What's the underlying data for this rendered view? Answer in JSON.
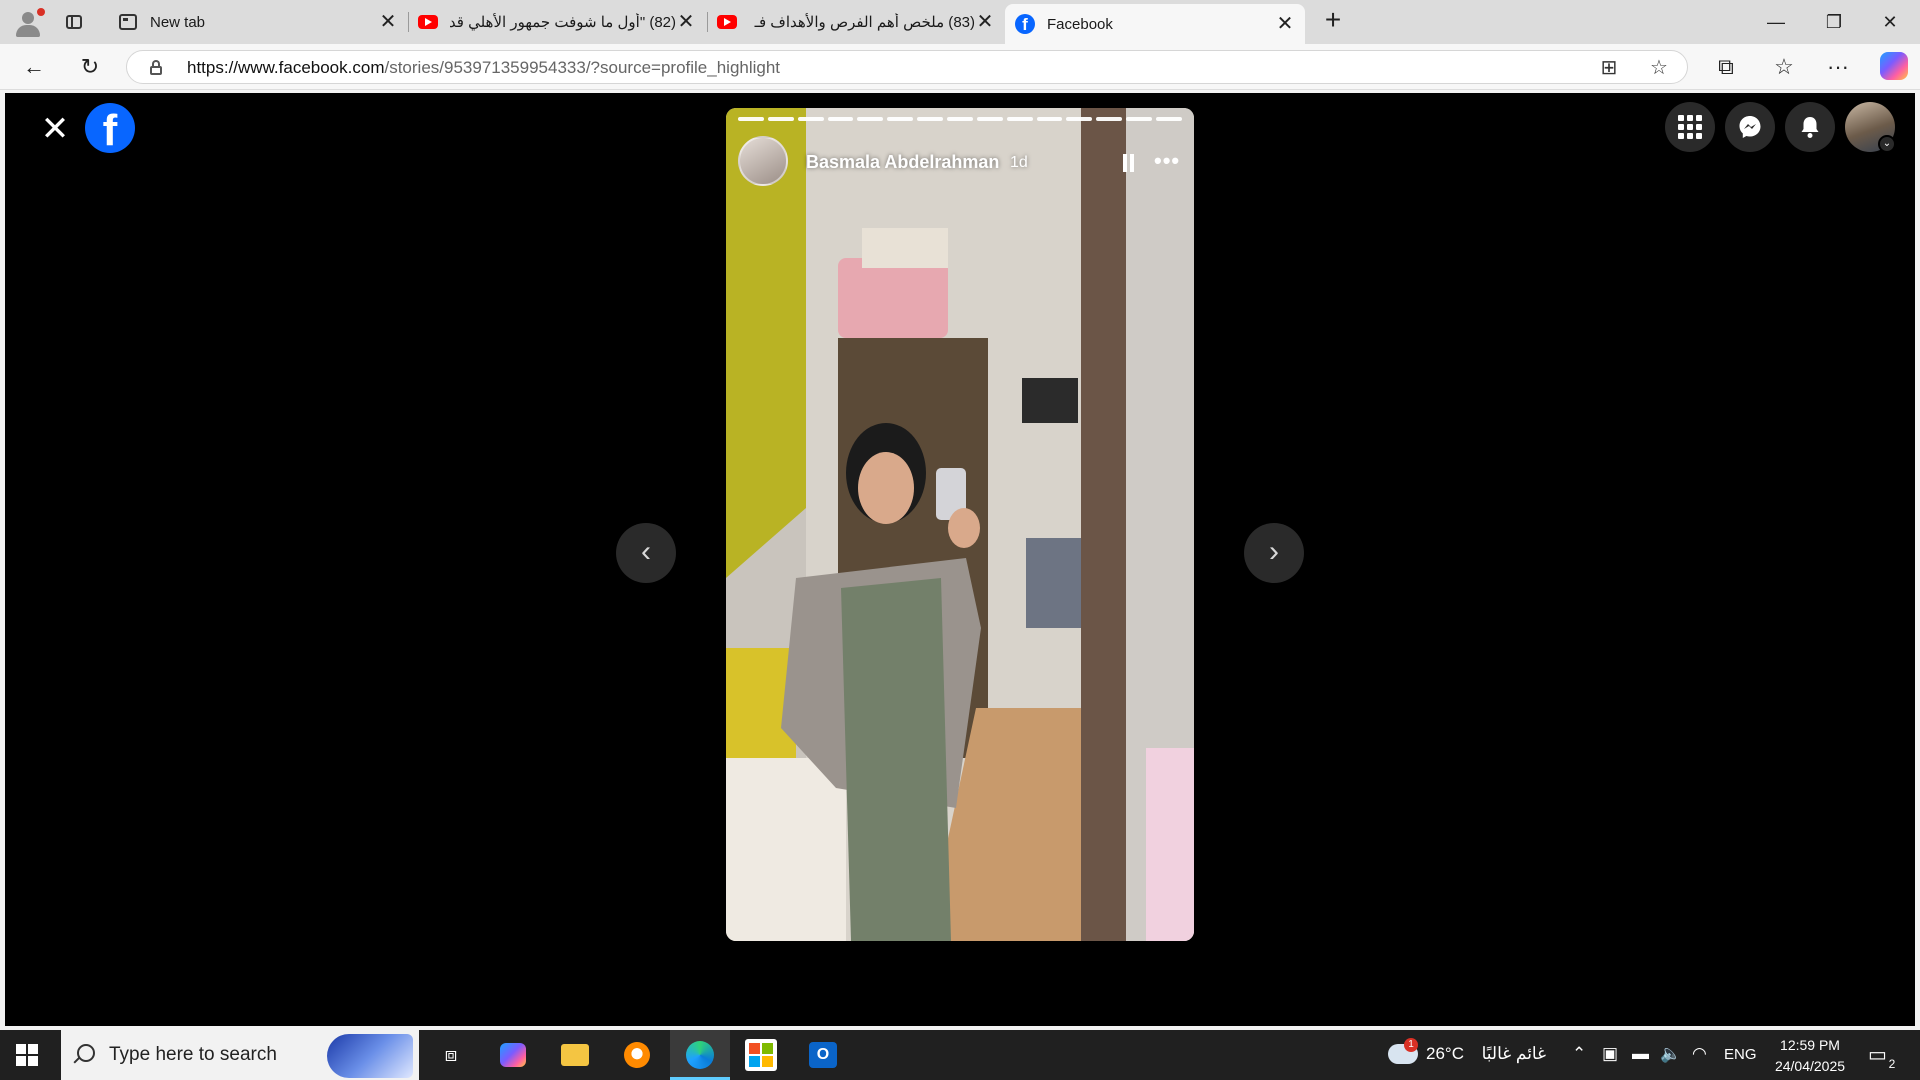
{
  "browser": {
    "tabs": [
      {
        "title": "New tab",
        "icon": "new-tab-icon",
        "active": false
      },
      {
        "title": "(82) \"أول ما شوفت جمهور الأهلي قد",
        "icon": "youtube-icon",
        "active": false
      },
      {
        "title": "(83) ملخص أهم الفرص والأهداف فـ",
        "icon": "youtube-icon",
        "active": false
      },
      {
        "title": "Facebook",
        "icon": "facebook-icon",
        "active": true
      }
    ],
    "url_domain": "https://www.facebook.com",
    "url_path": "/stories/953971359954333/?source=profile_highlight",
    "window_controls": {
      "minimize": "—",
      "restore": "❐",
      "close": "✕"
    }
  },
  "story": {
    "author": "Basmala Abdelrahman",
    "age": "1d",
    "segments": 15,
    "photo_palette": {
      "wall_left": "#b9b324",
      "wall": "#c9c4bd",
      "scrubs": "#73806a",
      "cardigan": "#9a938d",
      "floor": "#c89a6c",
      "mirror_frame": "#6b5547"
    }
  },
  "taskbar": {
    "search_placeholder": "Type here to search",
    "weather_temp": "26°C",
    "weather_text": "غائم غالبًا",
    "weather_badge": "1",
    "language": "ENG",
    "time": "12:59 PM",
    "date": "24/04/2025",
    "notification_count": "2"
  },
  "colors": {
    "facebook_blue": "#0866ff",
    "page_bg": "#000000",
    "taskbar_bg": "#202020"
  }
}
